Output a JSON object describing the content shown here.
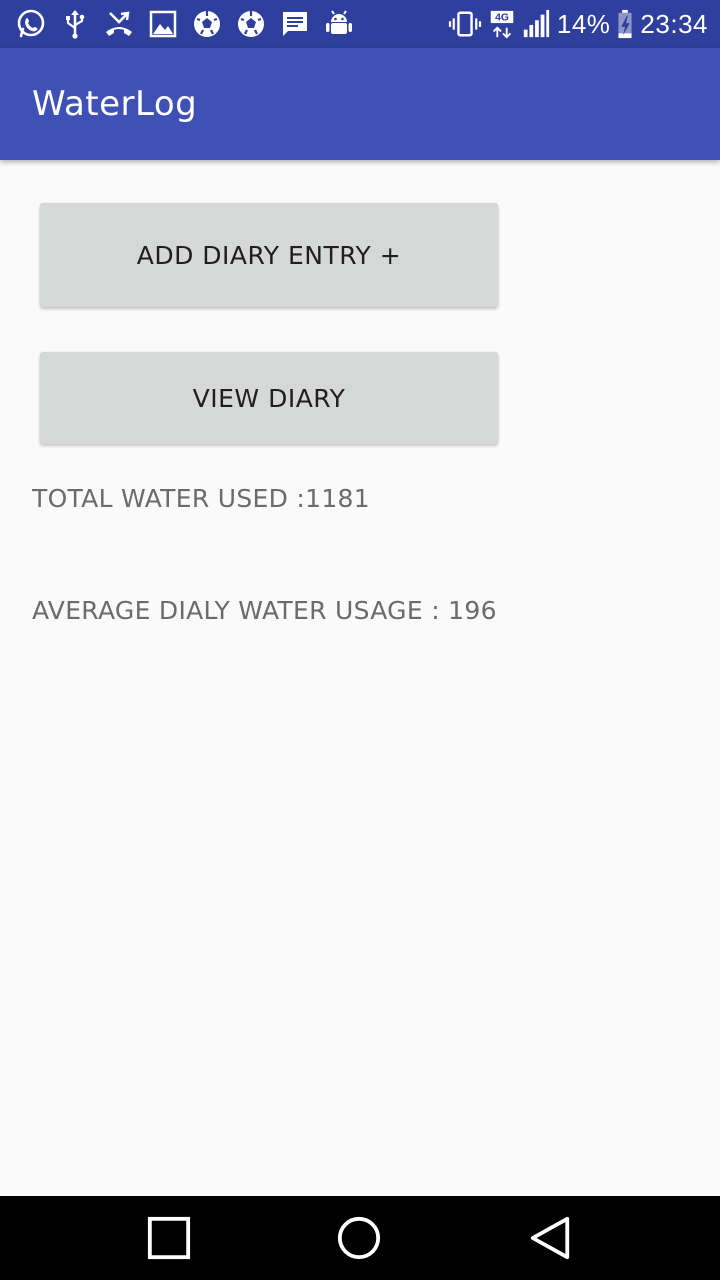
{
  "status_bar": {
    "left_icons": [
      "whatsapp-icon",
      "usb-icon",
      "missed-call-icon",
      "image-icon",
      "soccer-ball-icon",
      "soccer-ball-icon",
      "message-icon",
      "android-debug-icon"
    ],
    "right_icons": [
      "vibrate-icon",
      "network-4g-icon",
      "signal-icon",
      "battery-charging-icon"
    ],
    "network_label": "4G",
    "battery": "14%",
    "time": "23:34"
  },
  "app_bar": {
    "title": "WaterLog"
  },
  "actions": {
    "add_entry_label": "ADD DIARY ENTRY +",
    "view_diary_label": "VIEW DIARY"
  },
  "stats": {
    "total_label": "TOTAL WATER USED :1181",
    "average_label": "AVERAGE DIALY WATER USAGE : 196"
  },
  "nav_bar": {
    "buttons": [
      "recent-apps",
      "home",
      "back"
    ]
  },
  "colors": {
    "status_bar": "#2f3f9e",
    "app_bar": "#3f51b5",
    "button": "#d6d7d7",
    "background": "#fafafa",
    "stat_text": "#6b6b6b",
    "nav_bar": "#000000"
  }
}
